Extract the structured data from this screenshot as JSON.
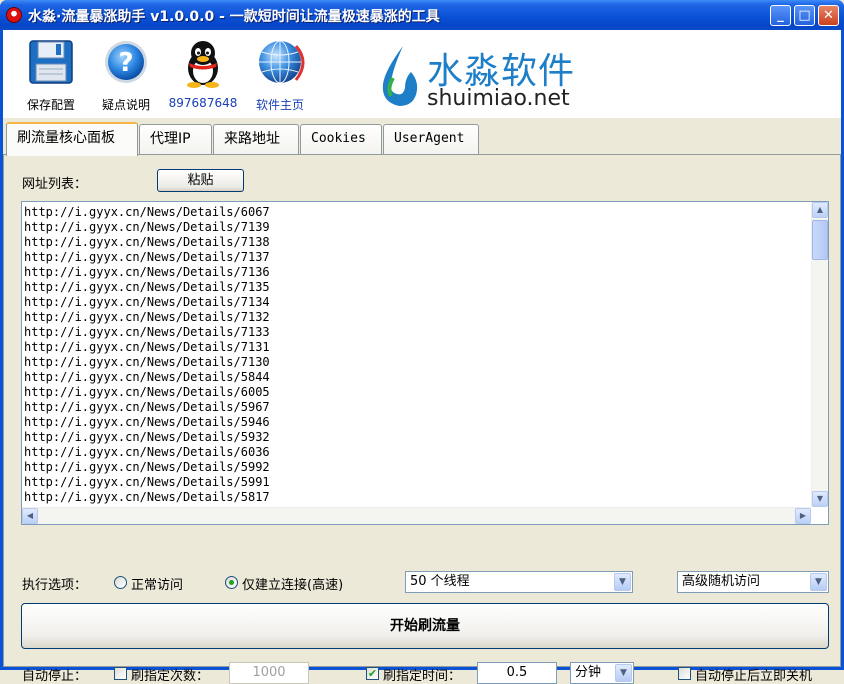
{
  "window": {
    "title": "水淼·流量暴涨助手 v1.0.0.0 - 一款短时间让流量极速暴涨的工具",
    "minimize": "_",
    "maximize": "□",
    "close": "✕"
  },
  "toolbar": {
    "items": [
      {
        "label": "保存配置",
        "icon": "floppy-disk-icon",
        "color": "#000000"
      },
      {
        "label": "疑点说明",
        "icon": "help-icon",
        "color": "#000000"
      },
      {
        "label": "897687648",
        "icon": "qq-penguin-icon",
        "color": "#1a40b8"
      },
      {
        "label": "软件主页",
        "icon": "globe-icon",
        "color": "#1a40b8"
      }
    ],
    "brand": {
      "name": "水淼软件",
      "url": "shuimiao.net"
    }
  },
  "tabs": [
    {
      "label": "刷流量核心面板",
      "active": true
    },
    {
      "label": "代理IP",
      "active": false
    },
    {
      "label": "来路地址",
      "active": false
    },
    {
      "label": "Cookies",
      "active": false
    },
    {
      "label": "UserAgent",
      "active": false
    }
  ],
  "panel": {
    "url_list_label": "网址列表：",
    "paste_button": "粘贴",
    "urls": [
      "http://i.gyyx.cn/News/Details/6067",
      "http://i.gyyx.cn/News/Details/7139",
      "http://i.gyyx.cn/News/Details/7138",
      "http://i.gyyx.cn/News/Details/7137",
      "http://i.gyyx.cn/News/Details/7136",
      "http://i.gyyx.cn/News/Details/7135",
      "http://i.gyyx.cn/News/Details/7134",
      "http://i.gyyx.cn/News/Details/7132",
      "http://i.gyyx.cn/News/Details/7133",
      "http://i.gyyx.cn/News/Details/7131",
      "http://i.gyyx.cn/News/Details/7130",
      "http://i.gyyx.cn/News/Details/5844",
      "http://i.gyyx.cn/News/Details/6005",
      "http://i.gyyx.cn/News/Details/5967",
      "http://i.gyyx.cn/News/Details/5946",
      "http://i.gyyx.cn/News/Details/5932",
      "http://i.gyyx.cn/News/Details/6036",
      "http://i.gyyx.cn/News/Details/5992",
      "http://i.gyyx.cn/News/Details/5991",
      "http://i.gyyx.cn/News/Details/5817"
    ],
    "exec_label": "执行选项：",
    "radio_normal": "正常访问",
    "radio_connect": "仅建立连接(高速)",
    "radio_selected": "仅建立连接(高速)",
    "threads": "50 个线程",
    "visit_mode": "高级随机访问",
    "start_button": "开始刷流量",
    "autostop_label": "自动停止：",
    "count_check_label": "刷指定次数：",
    "count_checked": false,
    "count_value": "1000",
    "time_check_label": "刷指定时间：",
    "time_checked": true,
    "time_value": "0.5",
    "time_unit": "分钟",
    "shutdown_label": "自动停止后立即关机",
    "shutdown_checked": false
  }
}
